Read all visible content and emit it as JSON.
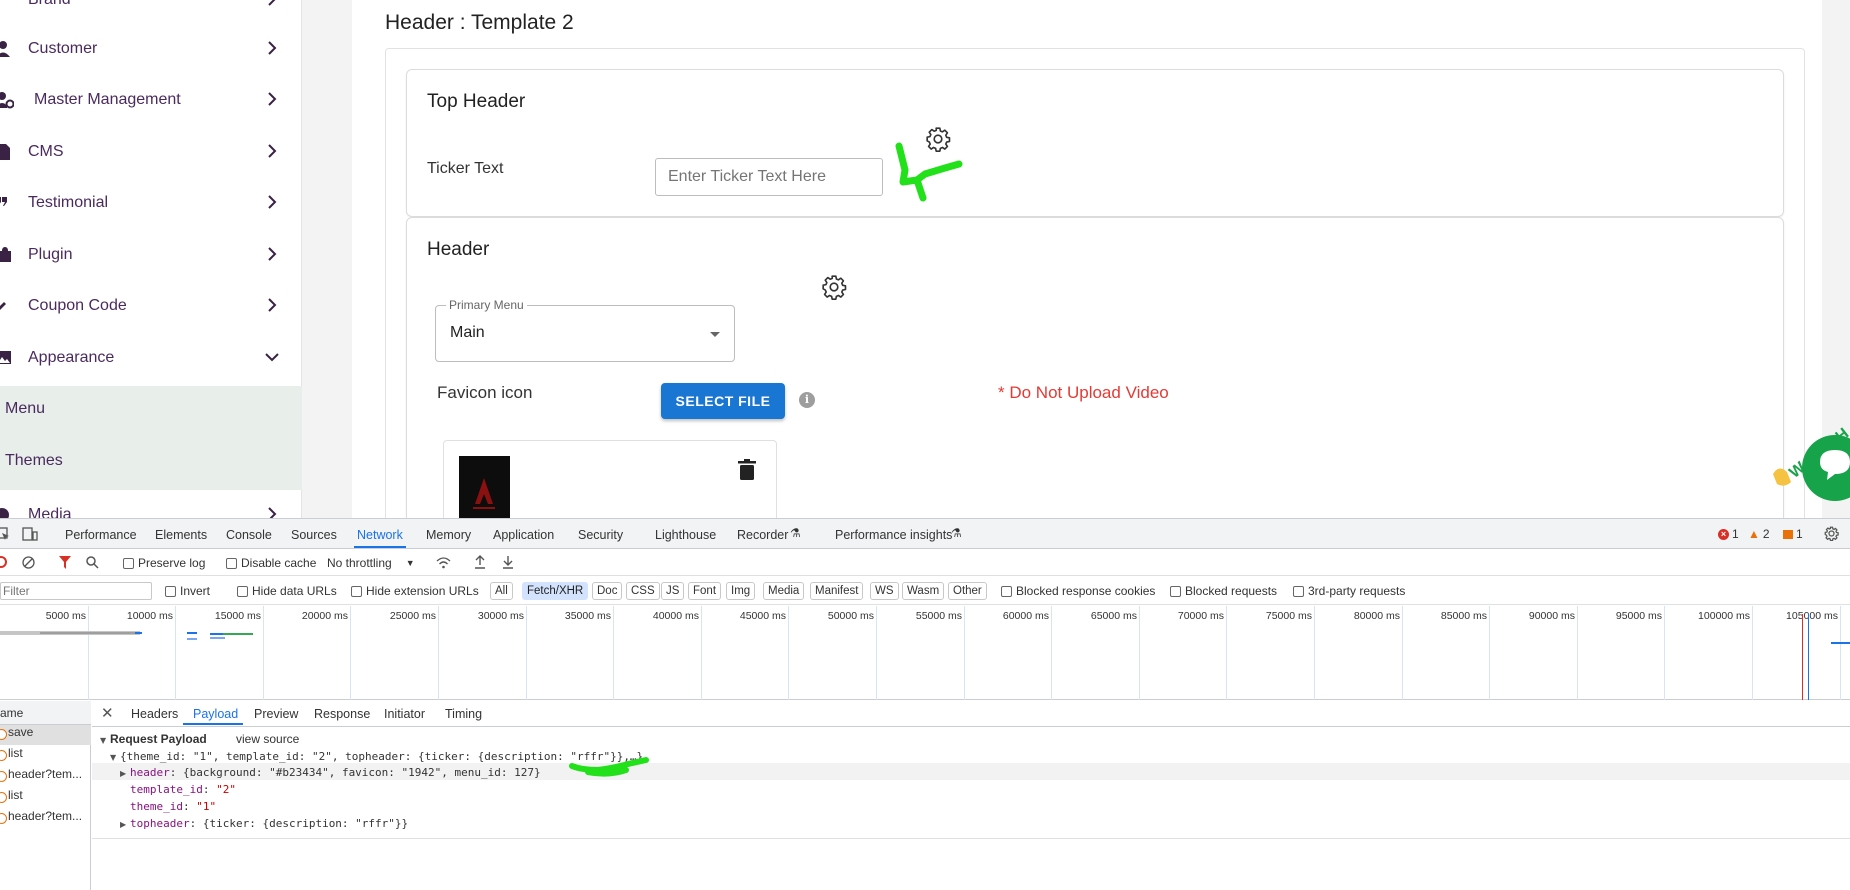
{
  "sidebar": {
    "items": [
      {
        "label": "Brand",
        "icon": "brand-icon"
      },
      {
        "label": "Customer",
        "icon": "user-icon"
      },
      {
        "label": "Master Management",
        "icon": "user-gear-icon"
      },
      {
        "label": "CMS",
        "icon": "file-icon"
      },
      {
        "label": "Testimonial",
        "icon": "quote-icon"
      },
      {
        "label": "Plugin",
        "icon": "puzzle-icon"
      },
      {
        "label": "Coupon Code",
        "icon": "tag-icon"
      },
      {
        "label": "Appearance",
        "icon": "image-icon"
      },
      {
        "label": "Media",
        "icon": "media-icon"
      }
    ],
    "sub_items": [
      "Menu",
      "Themes"
    ]
  },
  "page": {
    "title": "Header : Template 2",
    "top_header": {
      "title": "Top Header",
      "ticker_label": "Ticker Text",
      "ticker_placeholder": "Enter Ticker Text Here",
      "ticker_value": ""
    },
    "header": {
      "title": "Header",
      "primary_menu_label": "Primary Menu",
      "primary_menu_value": "Main",
      "favicon_label": "Favicon icon",
      "select_file_label": "SELECT FILE",
      "warning": "* Do Not Upload Video"
    },
    "chat_widget_text": "We Are H"
  },
  "devtools": {
    "tabs": [
      "Performance",
      "Elements",
      "Console",
      "Sources",
      "Network",
      "Memory",
      "Application",
      "Security",
      "Lighthouse",
      "Recorder",
      "Performance insights"
    ],
    "active_tab": "Network",
    "errors": "1",
    "warnings": "2",
    "issues": "1",
    "toolbar": {
      "preserve_log": "Preserve log",
      "disable_cache": "Disable cache",
      "throttling": "No throttling"
    },
    "filter_bar": {
      "filter_placeholder": "Filter",
      "invert": "Invert",
      "hide_data_urls": "Hide data URLs",
      "hide_extension_urls": "Hide extension URLs",
      "types": [
        "All",
        "Fetch/XHR",
        "Doc",
        "CSS",
        "JS",
        "Font",
        "Img",
        "Media",
        "Manifest",
        "WS",
        "Wasm",
        "Other"
      ],
      "active_type": "Fetch/XHR",
      "blocked_cookies": "Blocked response cookies",
      "blocked_requests": "Blocked requests",
      "third_party": "3rd-party requests"
    },
    "timeline_ticks": [
      "5000 ms",
      "10000 ms",
      "15000 ms",
      "20000 ms",
      "25000 ms",
      "30000 ms",
      "35000 ms",
      "40000 ms",
      "45000 ms",
      "50000 ms",
      "55000 ms",
      "60000 ms",
      "65000 ms",
      "70000 ms",
      "75000 ms",
      "80000 ms",
      "85000 ms",
      "90000 ms",
      "95000 ms",
      "100000 ms",
      "105000 ms"
    ],
    "request_list_header": "ame",
    "requests": [
      "save",
      "list",
      "header?tem...",
      "list",
      "header?tem..."
    ],
    "detail_tabs": [
      "Headers",
      "Payload",
      "Preview",
      "Response",
      "Initiator",
      "Timing"
    ],
    "active_detail_tab": "Payload",
    "payload": {
      "section_title": "Request Payload",
      "view_source": "view source",
      "summary": "{theme_id: \"1\", template_id: \"2\", topheader: {ticker: {description: \"rffr\"}},…}",
      "header_key": "header",
      "header_value": "{background: \"#b23434\", favicon: \"1942\", menu_id: 127}",
      "template_key": "template_id",
      "template_value": "\"2\"",
      "theme_key": "theme_id",
      "theme_value": "\"1\"",
      "topheader_key": "topheader",
      "topheader_value": "{ticker: {description: \"rffr\"}}"
    }
  },
  "colors": {
    "accent_blue": "#1976d2",
    "warning_red": "#e53935",
    "annotation_green": "#22e01a",
    "sidebar_sub_bg": "#e8efea",
    "chat_green": "#16a34a"
  }
}
